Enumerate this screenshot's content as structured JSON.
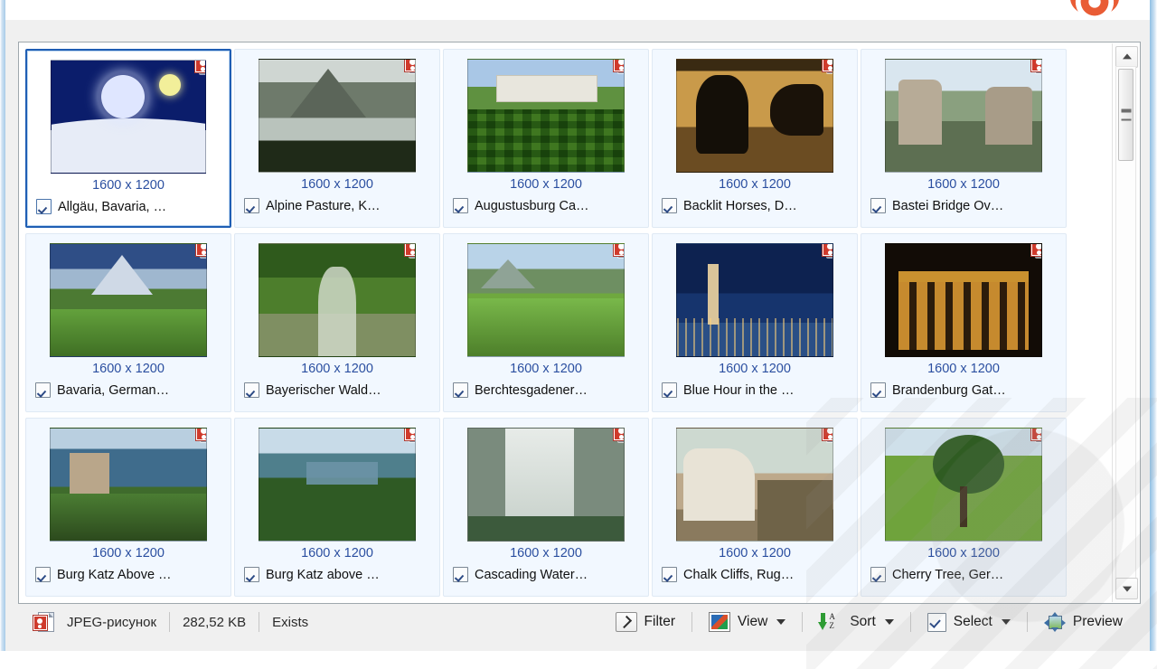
{
  "window": {
    "help_icon": "lifesaver-icon"
  },
  "grid": {
    "scrollbar": {
      "up_arrow": "scroll-up-arrow",
      "down_arrow": "scroll-down-arrow",
      "thumb": "scroll-thumb"
    },
    "dimension_label": "1600 x 1200",
    "items": [
      {
        "name": "Allgäu, Bavaria, …",
        "dims": "1600 x 1200",
        "checked": true,
        "selected": true,
        "thumb": "frosted tree at night with moon on snow",
        "css": "t1"
      },
      {
        "name": "Alpine Pasture, K…",
        "dims": "1600 x 1200",
        "checked": true,
        "selected": false,
        "thumb": "alpine mountains with fog and pines",
        "css": "t2"
      },
      {
        "name": "Augustusburg Ca…",
        "dims": "1600 x 1200",
        "checked": true,
        "selected": false,
        "thumb": "baroque palace with hedge maze garden",
        "css": "t3"
      },
      {
        "name": "Backlit Horses, D…",
        "dims": "1600 x 1200",
        "checked": true,
        "selected": false,
        "thumb": "two horses silhouetted in golden dust",
        "css": "t4"
      },
      {
        "name": "Bastei Bridge Ov…",
        "dims": "1600 x 1200",
        "checked": true,
        "selected": false,
        "thumb": "sandstone rock bridge in forest",
        "css": "t5"
      },
      {
        "name": "Bavaria, German…",
        "dims": "1600 x 1200",
        "checked": true,
        "selected": false,
        "thumb": "mountain lake meadow with peaks",
        "css": "t6"
      },
      {
        "name": "Bayerischer Wald…",
        "dims": "1600 x 1200",
        "checked": true,
        "selected": false,
        "thumb": "mossy forest stream with boulders",
        "css": "t7"
      },
      {
        "name": "Berchtesgadener…",
        "dims": "1600 x 1200",
        "checked": true,
        "selected": false,
        "thumb": "green alpine valley below mountains",
        "css": "t8"
      },
      {
        "name": "Blue Hour in the …",
        "dims": "1600 x 1200",
        "checked": true,
        "selected": false,
        "thumb": "church town at blue hour twilight",
        "css": "t9"
      },
      {
        "name": "Brandenburg Gat…",
        "dims": "1600 x 1200",
        "checked": true,
        "selected": false,
        "thumb": "Brandenburg Gate lit at night",
        "css": "t10"
      },
      {
        "name": "Burg Katz Above …",
        "dims": "1600 x 1200",
        "checked": true,
        "selected": false,
        "thumb": "castle above the Rhine river",
        "css": "t11"
      },
      {
        "name": "Burg Katz above …",
        "dims": "1600 x 1200",
        "checked": true,
        "selected": false,
        "thumb": "river valley overlook with castle",
        "css": "t12"
      },
      {
        "name": "Cascading Water…",
        "dims": "1600 x 1200",
        "checked": true,
        "selected": false,
        "thumb": "wide waterfall over rock face",
        "css": "t13"
      },
      {
        "name": "Chalk Cliffs, Rug…",
        "dims": "1600 x 1200",
        "checked": true,
        "selected": false,
        "thumb": "white chalk cliffs on the coast",
        "css": "t14"
      },
      {
        "name": "Cherry Tree, Ger…",
        "dims": "1600 x 1200",
        "checked": true,
        "selected": false,
        "thumb": "large tree on a green field",
        "css": "t15"
      }
    ]
  },
  "statusbar": {
    "file_type_icon": "jpeg-file-icon",
    "file_type": "JPEG-рисунок",
    "file_size": "282,52 KB",
    "file_state": "Exists",
    "buttons": {
      "filter": {
        "label": "Filter",
        "icon": "filter-icon"
      },
      "view": {
        "label": "View",
        "icon": "view-picture-icon",
        "caret": "chevron-down-icon"
      },
      "sort": {
        "label": "Sort",
        "icon": "sort-az-icon",
        "caret": "chevron-down-icon"
      },
      "select": {
        "label": "Select",
        "icon": "select-checkbox-icon",
        "caret": "chevron-down-icon"
      },
      "preview": {
        "label": "Preview",
        "icon": "preview-icon"
      }
    }
  },
  "colors": {
    "accent_blue": "#1f5eb4",
    "dims_text": "#2b4fa0",
    "tile_bg": "#f2f8ff",
    "panel_bg": "#ffffff",
    "chrome_bg": "#f0f0f0"
  }
}
